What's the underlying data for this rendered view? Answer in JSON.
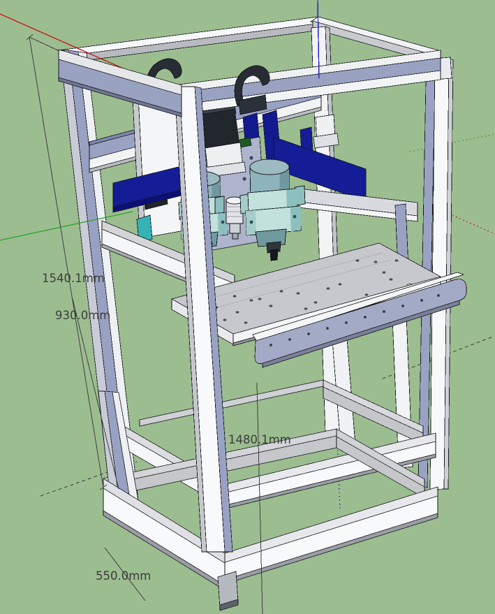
{
  "viewport": {
    "app": "3D CAD model viewport",
    "background_color": "#9cbd90",
    "model_name": "Dual-spindle CNC machine frame",
    "components": [
      "outer frame",
      "gantry beam",
      "left spindle motor",
      "right spindle motor",
      "center tool holder",
      "perforated work table",
      "support rails",
      "base frame"
    ]
  },
  "dimensions": {
    "overall_height": "1540.1mm",
    "table_height": "930.0mm",
    "frame_depth": "1480.1mm",
    "frame_width": "550.0mm"
  },
  "axes": {
    "x_color": "#cc1111",
    "y_color": "#2ba52b",
    "z_color": "#2222cc",
    "style": "solid positive direction, dotted negative direction"
  },
  "palette": {
    "frame_white": "#f8f9fa",
    "frame_lavender": "#9aa2c4",
    "panel_navy": "#141c96",
    "spindle_teal": "#c2e0dc",
    "table_gray": "#c6c8cd",
    "motor_black": "#22262d"
  }
}
